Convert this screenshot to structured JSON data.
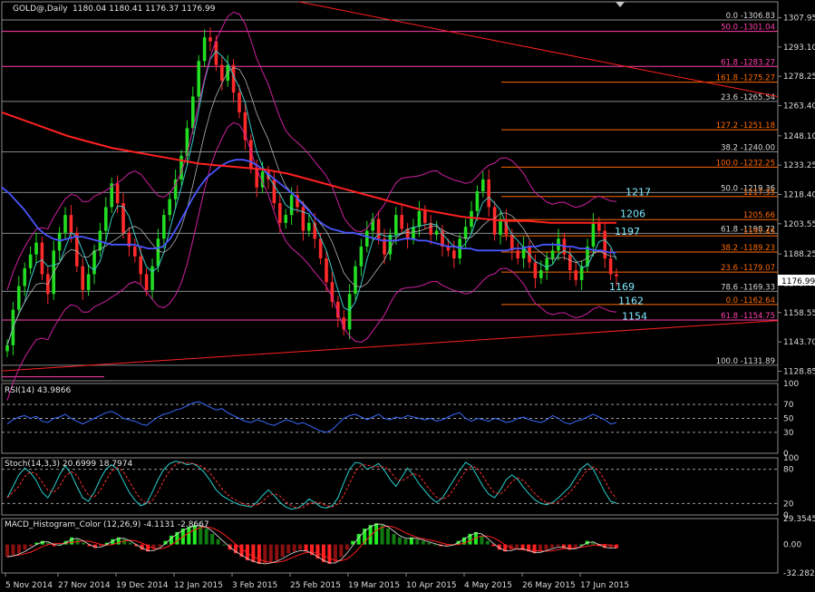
{
  "window": {
    "symbol_label": "GOLD@,Daily",
    "ohlc_text": "1180.04 1180.41 1176.37 1176.99"
  },
  "chart_data": {
    "type": "line",
    "title": "GOLD@,Daily  1180.04 1180.41 1176.37 1176.99",
    "x_ticks": [
      "5 Nov 2014",
      "27 Nov 2014",
      "19 Dec 2014",
      "12 Jan 2015",
      "3 Feb 2015",
      "25 Feb 2015",
      "19 Mar 2015",
      "10 Apr 2015",
      "4 May 2015",
      "26 May 2015",
      "17 Jun 2015"
    ],
    "price": {
      "ylim": [
        1124,
        1316
      ],
      "y_ticks": [
        "1307.95",
        "1293.10",
        "1278.25",
        "1263.40",
        "1248.10",
        "1233.25",
        "1218.40",
        "1203.55",
        "1188.25",
        "1173.40",
        "1158.55",
        "1143.70",
        "1128.85"
      ],
      "current_price_label": "1176.99",
      "current_price": 1176.99,
      "closes": [
        1142,
        1160,
        1172,
        1181,
        1188,
        1194,
        1178,
        1168,
        1190,
        1199,
        1208,
        1199,
        1182,
        1170,
        1178,
        1190,
        1200,
        1212,
        1224,
        1214,
        1199,
        1192,
        1187,
        1178,
        1170,
        1182,
        1196,
        1208,
        1216,
        1226,
        1238,
        1252,
        1268,
        1286,
        1298,
        1296,
        1284,
        1276,
        1284,
        1270,
        1260,
        1246,
        1232,
        1222,
        1230,
        1226,
        1214,
        1204,
        1208,
        1218,
        1212,
        1200,
        1204,
        1196,
        1186,
        1174,
        1164,
        1156,
        1150,
        1168,
        1182,
        1192,
        1200,
        1206,
        1196,
        1188,
        1198,
        1208,
        1201,
        1196,
        1202,
        1210,
        1204,
        1198,
        1200,
        1192,
        1190,
        1186,
        1196,
        1202,
        1210,
        1220,
        1226,
        1212,
        1198,
        1206,
        1198,
        1190,
        1186,
        1192,
        1184,
        1176,
        1180,
        1186,
        1190,
        1196,
        1188,
        1180,
        1175,
        1182,
        1192,
        1204,
        1200,
        1186,
        1178,
        1176.99
      ],
      "series": [
        {
          "name": "MA",
          "color": "#4a55ff",
          "values": [
            1222,
            1219,
            1215,
            1211,
            1206,
            1201,
            1198,
            1196,
            1195,
            1196,
            1197,
            1197,
            1196,
            1195,
            1194,
            1193,
            1193,
            1193,
            1193,
            1192,
            1191,
            1191,
            1192,
            1196,
            1202,
            1209,
            1216,
            1222,
            1227,
            1230,
            1233,
            1235,
            1236,
            1236,
            1235,
            1233,
            1230,
            1227,
            1224,
            1221,
            1218,
            1214,
            1210,
            1206,
            1203,
            1201,
            1200,
            1199,
            1199,
            1198,
            1197,
            1196,
            1195,
            1195,
            1195,
            1196,
            1196,
            1195,
            1195,
            1194,
            1193,
            1192,
            1192,
            1191,
            1191,
            1190,
            1190,
            1190,
            1190,
            1190,
            1191,
            1191,
            1192,
            1192,
            1193,
            1193,
            1193,
            1192,
            1192,
            1191,
            1191,
            1190,
            1190,
            1189,
            1189
          ]
        },
        {
          "name": "MA",
          "color": "#ff2020",
          "values": [
            1260,
            1256,
            1252,
            1248,
            1245,
            1242,
            1240,
            1238,
            1236,
            1234,
            1233,
            1232,
            1231,
            1229,
            1226,
            1223,
            1220,
            1217,
            1214,
            1211,
            1209,
            1207,
            1206,
            1205,
            1205,
            1204,
            1204,
            1204,
            1204
          ]
        }
      ],
      "levels": [
        {
          "label": "0.0 -1306.83",
          "value": 1306.83,
          "color": "#9aa0a6"
        },
        {
          "label": "50.0 -1301.04",
          "value": 1301.04,
          "color": "#ff3fae"
        },
        {
          "label": "61.8 -1283.27",
          "value": 1283.27,
          "color": "#ff3fae"
        },
        {
          "label": "161.8 -1275.27",
          "value": 1275.27,
          "color": "#ff6a00"
        },
        {
          "label": "23.6 -1265.54",
          "value": 1265.54,
          "color": "#9aa0a6"
        },
        {
          "label": "127.2 -1251.18",
          "value": 1251.18,
          "color": "#ff6a00"
        },
        {
          "label": "38.2 -1240.00",
          "value": 1240.0,
          "color": "#9aa0a6"
        },
        {
          "label": "100.0 -1232.25",
          "value": 1232.25,
          "color": "#ff6a00"
        },
        {
          "label": "50.0 -1219.36",
          "value": 1219.36,
          "color": "#9aa0a6"
        },
        {
          "label": "1217.35",
          "value": 1217.35,
          "color": "#ff6a00"
        },
        {
          "label": "1205.66",
          "value": 1205.66,
          "color": "#ff6a00"
        },
        {
          "label": "61.8 -1198.72",
          "value": 1198.72,
          "color": "#9aa0a6"
        },
        {
          "label": "1197.45",
          "value": 1197.45,
          "color": "#ff6a00"
        },
        {
          "label": "38.2 -1189.23",
          "value": 1189.23,
          "color": "#ff6a00"
        },
        {
          "label": "23.6 -1179.07",
          "value": 1179.07,
          "color": "#ff6a00"
        },
        {
          "label": "78.6 -1169.33",
          "value": 1169.33,
          "color": "#9aa0a6"
        },
        {
          "label": "0.0 -1162.64",
          "value": 1162.64,
          "color": "#ff6a00"
        },
        {
          "label": "61.8 -1154.75",
          "value": 1154.75,
          "color": "#ff3fae"
        },
        {
          "label": "100.0 -1131.89",
          "value": 1131.89,
          "color": "#9aa0a6"
        }
      ],
      "annotations": [
        {
          "label": "1217",
          "value": 1217
        },
        {
          "label": "1206",
          "value": 1206
        },
        {
          "label": "1197",
          "value": 1197
        },
        {
          "label": "1169",
          "value": 1169
        },
        {
          "label": "1162",
          "value": 1162
        },
        {
          "label": "1154",
          "value": 1154
        }
      ]
    },
    "rsi": {
      "label": "RSI(14) 43.9866",
      "ylim": [
        0,
        100
      ],
      "y_ticks": [
        "100",
        "70",
        "50",
        "30",
        "0"
      ],
      "levels": [
        70,
        30
      ],
      "values": [
        42,
        48,
        52,
        54,
        50,
        53,
        46,
        44,
        50,
        52,
        56,
        50,
        46,
        42,
        46,
        50,
        54,
        58,
        60,
        56,
        50,
        48,
        46,
        42,
        40,
        46,
        52,
        56,
        58,
        62,
        64,
        68,
        72,
        74,
        70,
        66,
        62,
        64,
        58,
        54,
        50,
        46,
        44,
        48,
        46,
        42,
        40,
        44,
        48,
        46,
        42,
        44,
        40,
        36,
        32,
        30,
        34,
        42,
        50,
        54,
        56,
        52,
        48,
        52,
        56,
        50,
        48,
        52,
        50,
        54,
        52,
        50,
        48,
        50,
        46,
        48,
        52,
        56,
        58,
        50,
        46,
        50,
        48,
        46,
        50,
        48,
        44,
        46,
        50,
        52,
        48,
        46,
        44,
        48,
        54,
        50,
        44,
        42,
        46,
        48,
        52,
        56,
        52,
        48,
        42,
        44
      ]
    },
    "stoch": {
      "label": "Stoch(14,3,3) 20.6999 18.7974",
      "ylim": [
        0,
        100
      ],
      "y_ticks": [
        "100",
        "80",
        "20",
        "0"
      ],
      "levels": [
        80,
        20
      ],
      "main": [
        30,
        50,
        70,
        82,
        74,
        60,
        40,
        30,
        48,
        70,
        86,
        72,
        50,
        30,
        24,
        40,
        62,
        80,
        88,
        80,
        60,
        40,
        26,
        16,
        20,
        40,
        62,
        80,
        90,
        94,
        92,
        88,
        90,
        84,
        74,
        60,
        44,
        34,
        28,
        22,
        18,
        16,
        14,
        22,
        34,
        44,
        34,
        22,
        14,
        10,
        12,
        18,
        28,
        22,
        14,
        12,
        16,
        30,
        56,
        80,
        92,
        90,
        80,
        84,
        90,
        78,
        62,
        50,
        66,
        82,
        70,
        54,
        42,
        30,
        22,
        30,
        46,
        62,
        78,
        92,
        86,
        68,
        50,
        36,
        30,
        44,
        62,
        70,
        62,
        48,
        36,
        26,
        20,
        18,
        22,
        30,
        40,
        50,
        66,
        82,
        90,
        80,
        60,
        40,
        24,
        20.7
      ]
    },
    "macd": {
      "label": "MACD_Histogram_Color (12,26,9) -4.1131 -2.8667",
      "ylim": [
        -32.28,
        29.35
      ],
      "y_ticks": [
        "29.3545",
        "0.00",
        "-32.2827"
      ],
      "histogram": [
        -14,
        -12,
        -10,
        -6,
        -2,
        2,
        4,
        2,
        -2,
        0,
        4,
        8,
        6,
        2,
        -2,
        -4,
        -2,
        2,
        6,
        8,
        6,
        2,
        -2,
        -6,
        -8,
        -6,
        -2,
        4,
        10,
        14,
        18,
        20,
        22,
        21,
        18,
        12,
        6,
        0,
        -6,
        -10,
        -14,
        -18,
        -20,
        -22,
        -22,
        -20,
        -18,
        -14,
        -10,
        -8,
        -6,
        -8,
        -12,
        -16,
        -20,
        -22,
        -20,
        -14,
        -6,
        4,
        12,
        18,
        22,
        24,
        22,
        18,
        12,
        8,
        6,
        8,
        6,
        4,
        2,
        0,
        -2,
        -2,
        0,
        4,
        8,
        12,
        14,
        10,
        4,
        -2,
        -6,
        -8,
        -6,
        -4,
        -6,
        -8,
        -10,
        -8,
        -6,
        -4,
        -2,
        -4,
        -6,
        -4,
        0,
        4,
        2,
        -2,
        -4,
        -4,
        -4.1
      ]
    }
  }
}
